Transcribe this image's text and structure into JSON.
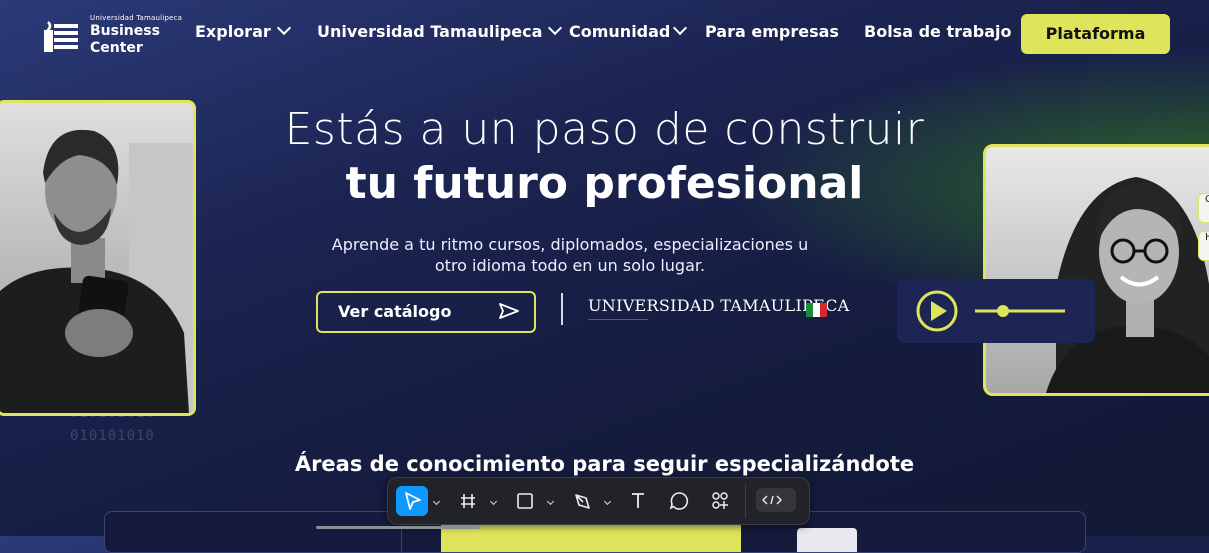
{
  "logo": {
    "small_text": "Universidad Tamaulipeca",
    "name": "Business Center"
  },
  "nav": {
    "items": [
      {
        "label": "Explorar",
        "dropdown": true
      },
      {
        "label": "Universidad Tamaulipeca",
        "dropdown": true
      },
      {
        "label": "Comunidad",
        "dropdown": true
      },
      {
        "label": "Para empresas",
        "dropdown": false
      },
      {
        "label": "Bolsa de trabajo",
        "dropdown": false
      }
    ],
    "cta": "Plataforma"
  },
  "hero": {
    "title_line1": "Estás a un paso de construir",
    "title_line2": "tu futuro profesional",
    "subtitle_line1": "Aprende a tu ritmo cursos, diplomados, especializaciones u",
    "subtitle_line2": "otro idioma todo en un solo lugar.",
    "catalog_button": "Ver catálogo",
    "university_name": "UNIVERSIDAD TAMAULIPECA",
    "binary_text": "010101010"
  },
  "side_chips": [
    "C",
    "H"
  ],
  "areas_title": "Áreas de conocimiento para seguir especializándote",
  "colors": {
    "accent": "#dfe55a",
    "background": "#141b3c",
    "toolbar_selected": "#0d99ff"
  },
  "toolbar": {
    "tools": [
      "move-tool",
      "frame-tool",
      "rectangle-tool",
      "pen-tool",
      "text-tool",
      "comment-tool",
      "components-tool"
    ],
    "selected": "move-tool"
  }
}
